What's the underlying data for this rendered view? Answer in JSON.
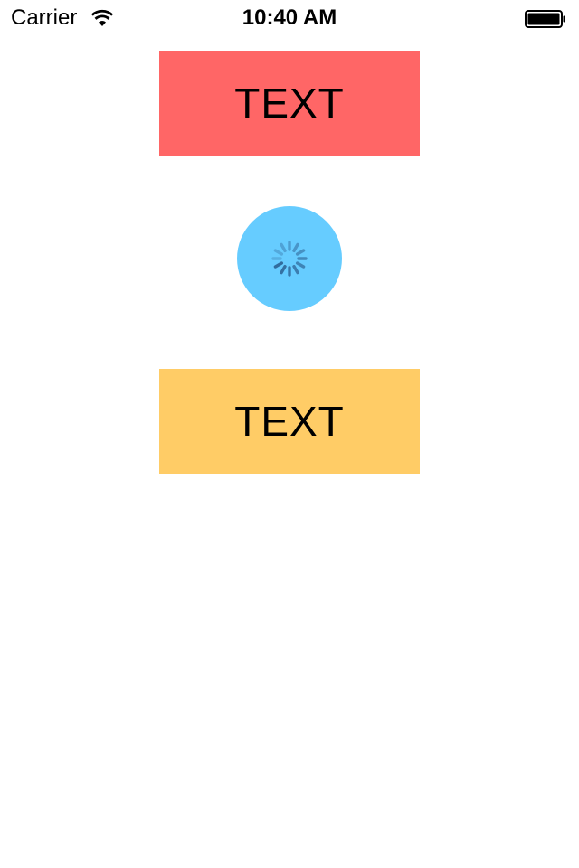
{
  "status_bar": {
    "carrier": "Carrier",
    "time": "10:40 AM",
    "icons": [
      "wifi-icon",
      "battery-icon"
    ]
  },
  "top_button": {
    "label": "TEXT",
    "color": "#ff6666"
  },
  "loading_indicator": {
    "icon": "activity-spinner-icon",
    "circle_color": "#66ccff"
  },
  "bottom_button": {
    "label": "TEXT",
    "color": "#ffcc66"
  }
}
